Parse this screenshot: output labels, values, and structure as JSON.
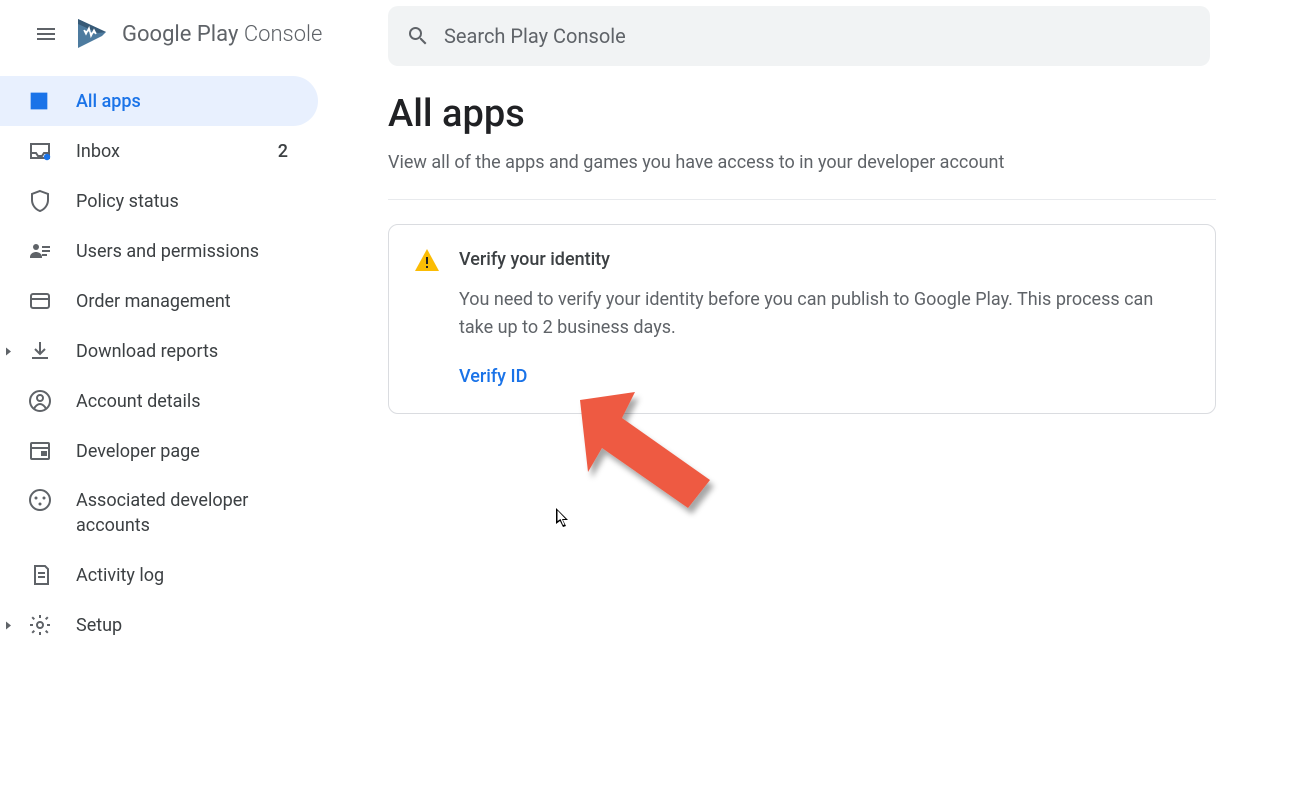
{
  "header": {
    "brand": "Google Play",
    "product": "Console"
  },
  "search": {
    "placeholder": "Search Play Console"
  },
  "sidebar": {
    "items": [
      {
        "label": "All apps",
        "active": true
      },
      {
        "label": "Inbox",
        "badge": "2"
      },
      {
        "label": "Policy status"
      },
      {
        "label": "Users and permissions"
      },
      {
        "label": "Order management"
      },
      {
        "label": "Download reports",
        "expandable": true
      },
      {
        "label": "Account details"
      },
      {
        "label": "Developer page"
      },
      {
        "label": "Associated developer accounts"
      },
      {
        "label": "Activity log"
      },
      {
        "label": "Setup",
        "expandable": true
      }
    ]
  },
  "main": {
    "title": "All apps",
    "subtitle": "View all of the apps and games you have access to in your developer account",
    "card": {
      "title": "Verify your identity",
      "text": "You need to verify your identity before you can publish to Google Play. This process can take up to 2 business days.",
      "link": "Verify ID"
    }
  }
}
